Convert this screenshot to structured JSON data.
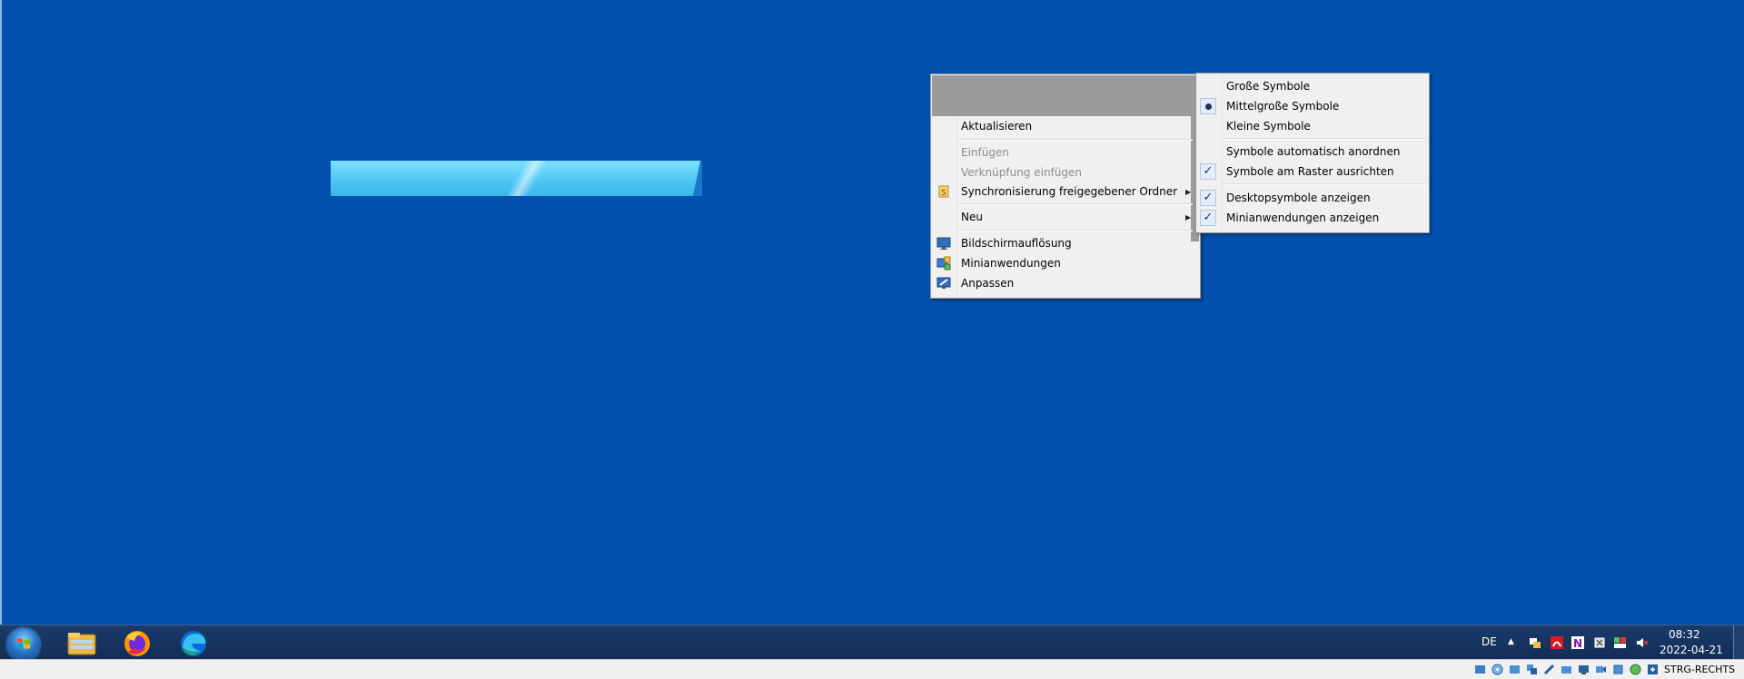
{
  "context_menu": {
    "items": [
      {
        "label": "Aktualisieren",
        "disabled": false
      },
      {
        "label": "Einfügen",
        "disabled": true
      },
      {
        "label": "Verknüpfung einfügen",
        "disabled": true
      },
      {
        "label": "Synchronisierung freigegebener Ordner",
        "icon": "sync-folder-icon",
        "submenu": true
      },
      {
        "label": "Neu",
        "submenu": true
      },
      {
        "label": "Bildschirmauflösung",
        "icon": "display-resolution-icon"
      },
      {
        "label": "Minianwendungen",
        "icon": "gadgets-icon"
      },
      {
        "label": "Anpassen",
        "icon": "personalize-icon"
      }
    ]
  },
  "view_submenu": {
    "items": [
      {
        "label": "Große Symbole",
        "mark": ""
      },
      {
        "label": "Mittelgroße Symbole",
        "mark": "radio"
      },
      {
        "label": "Kleine Symbole",
        "mark": ""
      },
      {
        "label": "Symbole automatisch anordnen",
        "mark": ""
      },
      {
        "label": "Symbole am Raster ausrichten",
        "mark": "check"
      },
      {
        "label": "Desktopsymbole anzeigen",
        "mark": "check"
      },
      {
        "label": "Minianwendungen anzeigen",
        "mark": "check"
      }
    ],
    "check_glyph": "✓"
  },
  "taskbar": {
    "apps": [
      "start-orb",
      "file-explorer-icon",
      "firefox-icon",
      "edge-icon"
    ],
    "language": "DE",
    "tray_arrow": "▲",
    "clock": {
      "time": "08:32",
      "date": "2022-04-21"
    }
  },
  "host_status": {
    "hotkey": "STRG-RECHTS"
  },
  "colors": {
    "desktop": "#0150ad",
    "menu_bg": "#f0f0f0",
    "taskbar": "#132d57"
  }
}
